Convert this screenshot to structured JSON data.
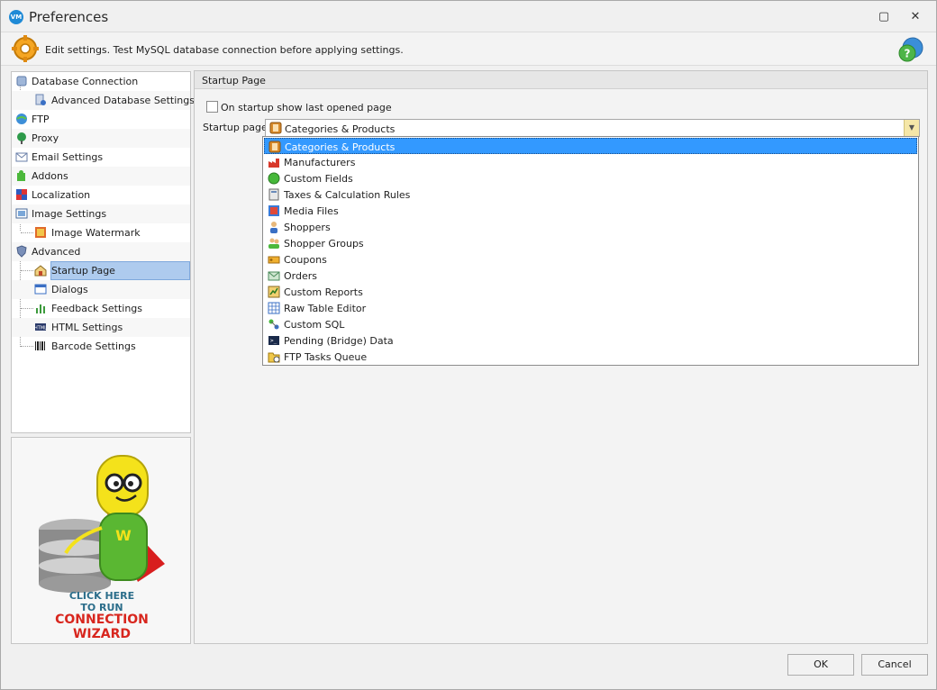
{
  "window": {
    "title": "Preferences"
  },
  "info": {
    "text": "Edit settings. Test MySQL database connection before applying settings."
  },
  "nav": {
    "items": [
      {
        "label": "Database Connection",
        "icon": "database-icon"
      },
      {
        "label": "Advanced Database Settings",
        "icon": "database-settings-icon"
      },
      {
        "label": "FTP",
        "icon": "globe-icon"
      },
      {
        "label": "Proxy",
        "icon": "proxy-icon"
      },
      {
        "label": "Email Settings",
        "icon": "envelope-icon"
      },
      {
        "label": "Addons",
        "icon": "puzzle-icon"
      },
      {
        "label": "Localization",
        "icon": "flag-icon"
      },
      {
        "label": "Image Settings",
        "icon": "image-icon"
      },
      {
        "label": "Image Watermark",
        "icon": "watermark-icon"
      },
      {
        "label": "Advanced",
        "icon": "shield-icon"
      },
      {
        "label": "Startup Page",
        "icon": "home-icon"
      },
      {
        "label": "Dialogs",
        "icon": "dialog-icon"
      },
      {
        "label": "Feedback Settings",
        "icon": "chart-icon"
      },
      {
        "label": "HTML Settings",
        "icon": "html-icon"
      },
      {
        "label": "Barcode Settings",
        "icon": "barcode-icon"
      }
    ],
    "selected": "Startup Page"
  },
  "wizard": {
    "line1": "CLICK HERE",
    "line2": "TO RUN",
    "line3": "CONNECTION",
    "line4": "WIZARD"
  },
  "content": {
    "header": "Startup Page",
    "checkbox_label": "On startup show last opened page",
    "checkbox_checked": false,
    "startup_label": "Startup page",
    "selected_value": "Categories & Products"
  },
  "dropdown": {
    "options": [
      {
        "label": "Categories & Products",
        "icon": "categories-icon"
      },
      {
        "label": "Manufacturers",
        "icon": "factory-icon"
      },
      {
        "label": "Custom Fields",
        "icon": "green-circle-icon"
      },
      {
        "label": "Taxes & Calculation Rules",
        "icon": "calculator-icon"
      },
      {
        "label": "Media Files",
        "icon": "media-icon"
      },
      {
        "label": "Shoppers",
        "icon": "user-icon"
      },
      {
        "label": "Shopper Groups",
        "icon": "users-icon"
      },
      {
        "label": "Coupons",
        "icon": "coupon-icon"
      },
      {
        "label": "Orders",
        "icon": "orders-icon"
      },
      {
        "label": "Custom Reports",
        "icon": "report-icon"
      },
      {
        "label": "Raw Table Editor",
        "icon": "table-icon"
      },
      {
        "label": "Custom SQL",
        "icon": "sql-icon"
      },
      {
        "label": "Pending (Bridge) Data",
        "icon": "terminal-icon"
      },
      {
        "label": "FTP Tasks Queue",
        "icon": "folder-clock-icon"
      }
    ]
  },
  "buttons": {
    "ok": "OK",
    "cancel": "Cancel"
  },
  "colors": {
    "accent": "#3399ff",
    "selection": "#aecbee"
  }
}
